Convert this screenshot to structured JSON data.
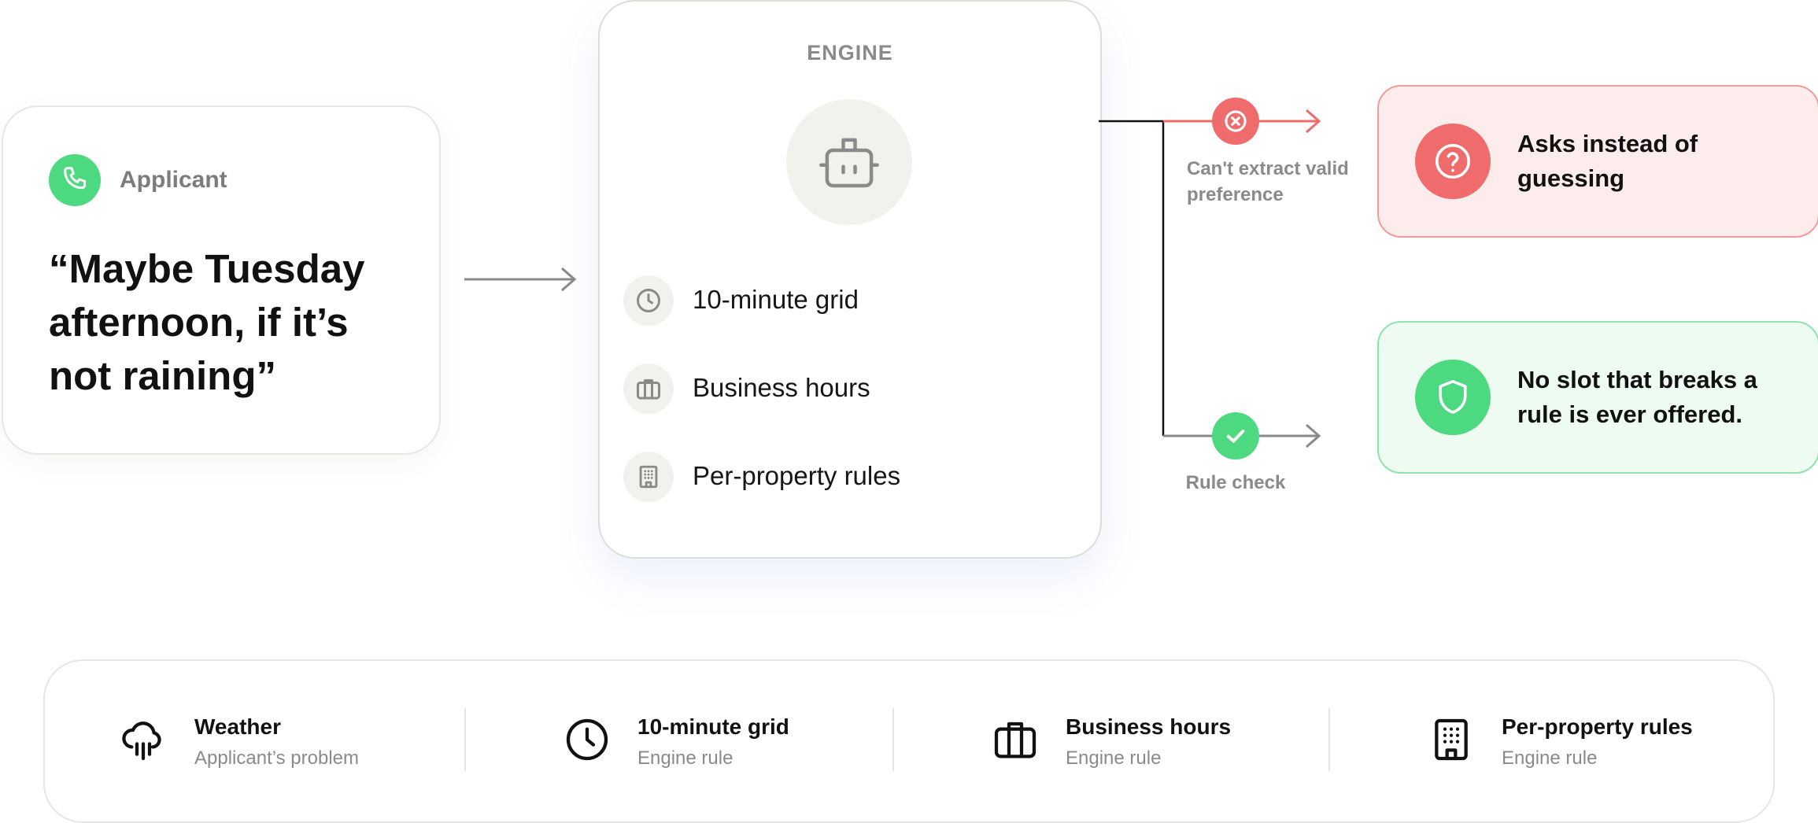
{
  "applicant": {
    "label": "Applicant",
    "quote": "“Maybe Tuesday afternoon, if it’s not raining”",
    "icon": "phone-icon"
  },
  "engine": {
    "title": "ENGINE",
    "icon": "robot-icon",
    "rules": [
      {
        "label": "10-minute grid",
        "icon": "clock-icon"
      },
      {
        "label": "Business hours",
        "icon": "briefcase-icon"
      },
      {
        "label": "Per-property rules",
        "icon": "building-icon"
      }
    ]
  },
  "branches": {
    "reject_label": "Can't extract valid preference",
    "check_label": "Rule check"
  },
  "outcomes": {
    "ask": {
      "text": "Asks instead of guessing",
      "icon": "question-icon"
    },
    "safe": {
      "text": "No slot that breaks a rule is ever offered.",
      "icon": "shield-icon"
    }
  },
  "legend": [
    {
      "title": "Weather",
      "subtitle": "Applicant’s problem",
      "icon": "rain-cloud-icon"
    },
    {
      "title": "10-minute grid",
      "subtitle": "Engine rule",
      "icon": "clock-icon"
    },
    {
      "title": "Business hours",
      "subtitle": "Engine rule",
      "icon": "briefcase-icon"
    },
    {
      "title": "Per-property rules",
      "subtitle": "Engine rule",
      "icon": "building-icon"
    }
  ],
  "colors": {
    "green": "#4cd97f",
    "red": "#f06b6b",
    "gray_line": "#8a8a8a",
    "icon_bg": "#f2f1ec"
  }
}
